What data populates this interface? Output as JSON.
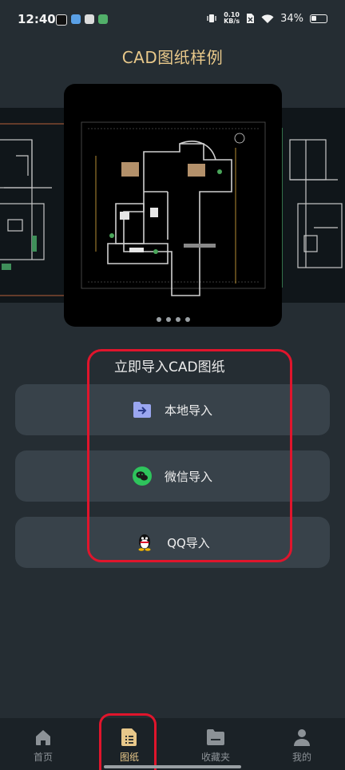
{
  "status_bar": {
    "time": "12:40",
    "speed_top": "0.10",
    "speed_bottom": "KB/s",
    "battery": "34%"
  },
  "page_title": "CAD图纸样例",
  "carousel": {
    "page_count": 4,
    "active_index": 0
  },
  "import_section": {
    "title": "立即导入CAD图纸",
    "buttons": [
      {
        "label": "本地导入",
        "icon": "folder-import-icon"
      },
      {
        "label": "微信导入",
        "icon": "wechat-icon"
      },
      {
        "label": "QQ导入",
        "icon": "qq-penguin-icon"
      }
    ]
  },
  "bottom_nav": {
    "items": [
      {
        "label": "首页",
        "icon": "home-icon",
        "active": false
      },
      {
        "label": "图纸",
        "icon": "drawing-list-icon",
        "active": true
      },
      {
        "label": "收藏夹",
        "icon": "folder-icon",
        "active": false
      },
      {
        "label": "我的",
        "icon": "person-icon",
        "active": false
      }
    ]
  },
  "colors": {
    "background": "#252d33",
    "accent": "#e8c88a",
    "button": "#38424a",
    "annotation": "#e0152c"
  }
}
